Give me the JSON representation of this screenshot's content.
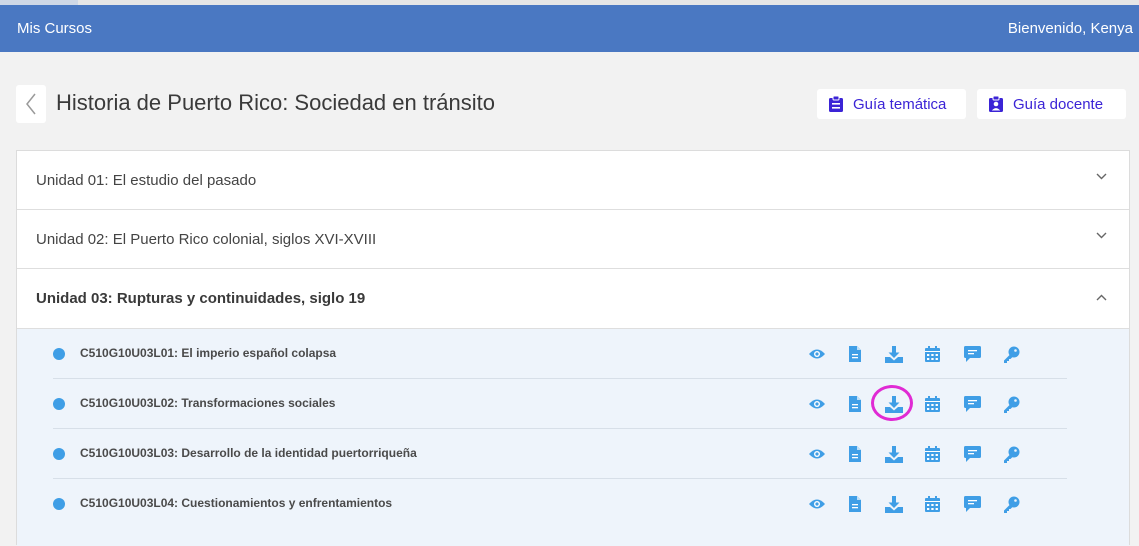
{
  "header": {
    "app_title": "Mis Cursos",
    "welcome": "Bienvenido, Kenya"
  },
  "course": {
    "title": "Historia de Puerto Rico: Sociedad en tránsito",
    "guide_tematica": "Guía temática",
    "guide_docente": "Guía docente"
  },
  "units": [
    {
      "label": "Unidad 01: El estudio del pasado",
      "expanded": false
    },
    {
      "label": "Unidad 02: El Puerto Rico colonial, siglos XVI-XVIII",
      "expanded": false
    },
    {
      "label": "Unidad 03: Rupturas y continuidades, siglo 19",
      "expanded": true
    }
  ],
  "lessons": [
    {
      "name": "C510G10U03L01: El imperio español colapsa"
    },
    {
      "name": "C510G10U03L02: Transformaciones sociales",
      "highlighted_action": "download"
    },
    {
      "name": "C510G10U03L03: Desarrollo de la identidad puertorriqueña"
    },
    {
      "name": "C510G10U03L04: Cuestionamientos y enfrentamientos"
    }
  ],
  "lesson_actions": [
    "eye-icon",
    "document-icon",
    "download-icon",
    "calendar-icon",
    "chat-icon",
    "key-icon"
  ],
  "colors": {
    "header_bg": "#4a78c2",
    "icon_blue": "#3f9ee6",
    "guide_text": "#3b24d6",
    "highlight_ring": "#e02ad4",
    "lessons_bg": "#eef4fb"
  }
}
